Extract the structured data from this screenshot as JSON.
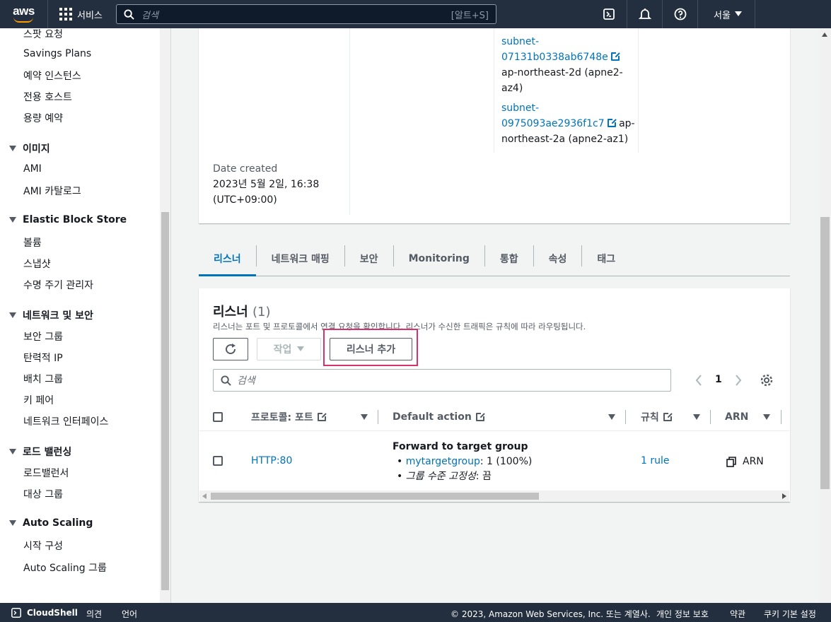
{
  "topbar": {
    "logo": "aws",
    "services_label": "서비스",
    "search_placeholder": "검색",
    "search_shortcut": "[알트+S]",
    "region": "서울"
  },
  "sidebar": {
    "items_top": [
      "스팟 요청",
      "Savings Plans",
      "예약 인스턴스",
      "전용 호스트",
      "용량 예약"
    ],
    "sections": [
      {
        "title": "이미지",
        "items": [
          "AMI",
          "AMI 카탈로그"
        ]
      },
      {
        "title": "Elastic Block Store",
        "items": [
          "볼륨",
          "스냅샷",
          "수명 주기 관리자"
        ]
      },
      {
        "title": "네트워크 및 보안",
        "items": [
          "보안 그룹",
          "탄력적 IP",
          "배치 그룹",
          "키 페어",
          "네트워크 인터페이스"
        ]
      },
      {
        "title": "로드 밸런싱",
        "items": [
          "로드밸런서",
          "대상 그룹"
        ]
      },
      {
        "title": "Auto Scaling",
        "items": [
          "시작 구성",
          "Auto Scaling 그룹"
        ]
      }
    ]
  },
  "details": {
    "subnets": [
      {
        "id_part1": "subnet-",
        "id_part2": "07131b0338ab6748e",
        "az_line1": "ap-northeast-2d (apne2-",
        "az_line2": "az4)"
      },
      {
        "id_part1": "subnet-",
        "id_part2": "0975093ae2936f1c7",
        "az_inline": "ap-",
        "az_line2": "northeast-2a (apne2-az1)"
      }
    ],
    "date_created_label": "Date created",
    "date_created_line1": "2023년 5월 2일, 16:38",
    "date_created_line2": "(UTC+09:00)"
  },
  "tabs": [
    "리스너",
    "네트워크 매핑",
    "보안",
    "Monitoring",
    "통합",
    "속성",
    "태그"
  ],
  "listeners": {
    "title": "리스너",
    "count": "(1)",
    "description": "리스너는 포트 및 프로토콜에서 연결 요청을 확인합니다. 리스너가 수신한 트래픽은 규칙에 따라 라우팅됩니다.",
    "actions_label": "작업",
    "add_label": "리스너 추가",
    "search_placeholder": "검색",
    "page": "1",
    "columns": {
      "protocol": "프로토콜: 포트",
      "default_action": "Default action",
      "rules": "규칙",
      "arn": "ARN"
    },
    "row": {
      "protocol": "HTTP:80",
      "action_title": "Forward to target group",
      "target_group": "mytargetgroup",
      "target_weight": ": 1 (100%)",
      "stickiness_label": "그룹 수준 고정성",
      "stickiness_value": ": 끔",
      "rules": "1 rule",
      "arn": "ARN"
    }
  },
  "footer": {
    "cloudshell": "CloudShell",
    "feedback": "의견",
    "language": "언어",
    "copyright": "© 2023, Amazon Web Services, Inc. 또는 계열사.",
    "privacy": "개인 정보 보호",
    "terms": "약관",
    "cookies": "쿠키 기본 설정"
  }
}
